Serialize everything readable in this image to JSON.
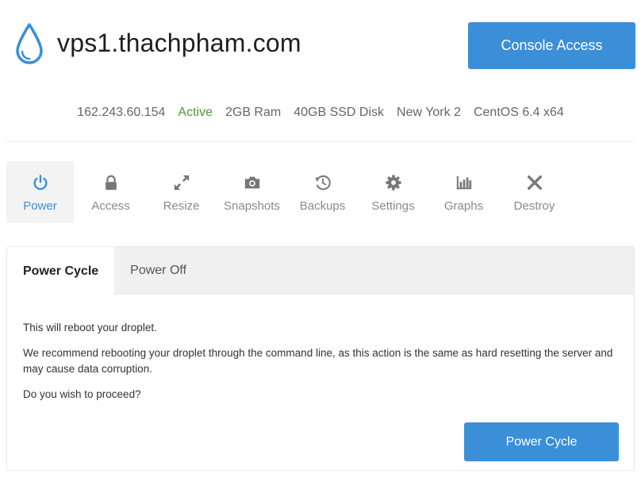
{
  "header": {
    "hostname": "vps1.thachpham.com",
    "console_label": "Console Access",
    "logo_icon": "droplet-icon"
  },
  "meta": {
    "ip": "162.243.60.154",
    "status": "Active",
    "ram": "2GB Ram",
    "disk": "40GB SSD Disk",
    "region": "New York 2",
    "os": "CentOS 6.4 x64"
  },
  "nav": [
    {
      "label": "Power",
      "icon": "power-icon",
      "selected": true
    },
    {
      "label": "Access",
      "icon": "lock-icon"
    },
    {
      "label": "Resize",
      "icon": "resize-icon"
    },
    {
      "label": "Snapshots",
      "icon": "camera-icon"
    },
    {
      "label": "Backups",
      "icon": "history-icon"
    },
    {
      "label": "Settings",
      "icon": "gear-icon"
    },
    {
      "label": "Graphs",
      "icon": "bar-chart-icon"
    },
    {
      "label": "Destroy",
      "icon": "x-icon"
    }
  ],
  "tabs": [
    {
      "label": "Power Cycle",
      "selected": true
    },
    {
      "label": "Power Off"
    }
  ],
  "panel": {
    "line1": "This will reboot your droplet.",
    "line2": "We recommend rebooting your droplet through the command line, as this action is the same as hard resetting the server and may cause data corruption.",
    "line3": "Do you wish to proceed?",
    "button_label": "Power Cycle"
  },
  "colors": {
    "accent": "#3a8fd8",
    "active_status": "#4c9a34"
  }
}
